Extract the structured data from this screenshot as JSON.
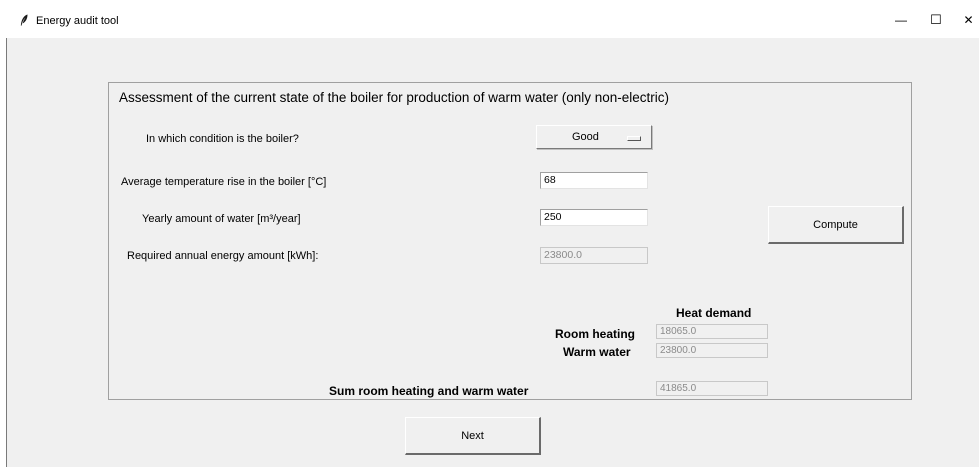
{
  "window": {
    "title": "Energy audit tool",
    "minimize_glyph": "—",
    "maximize_glyph": "☐",
    "close_glyph": "✕"
  },
  "frame": {
    "title": "Assessment of the current state of the boiler for production of warm water (only non-electric)"
  },
  "form": {
    "condition_label": "In which condition is the boiler?",
    "condition_value": "Good",
    "temp_label": "Average temperature rise in the boiler [°C]",
    "temp_value": "68",
    "water_label": "Yearly amount of water [m³/year]",
    "water_value": "250",
    "energy_label": "Required annual energy amount [kWh]:",
    "energy_value": "23800.0",
    "compute_label": "Compute"
  },
  "heat": {
    "header": "Heat demand",
    "room_label": "Room heating",
    "room_value": "18065.0",
    "warm_label": "Warm water",
    "warm_value": "23800.0",
    "sum_label": "Sum room heating and warm water",
    "sum_value": "41865.0"
  },
  "footer": {
    "next_label": "Next"
  },
  "icons": {
    "app": "feather-icon"
  }
}
